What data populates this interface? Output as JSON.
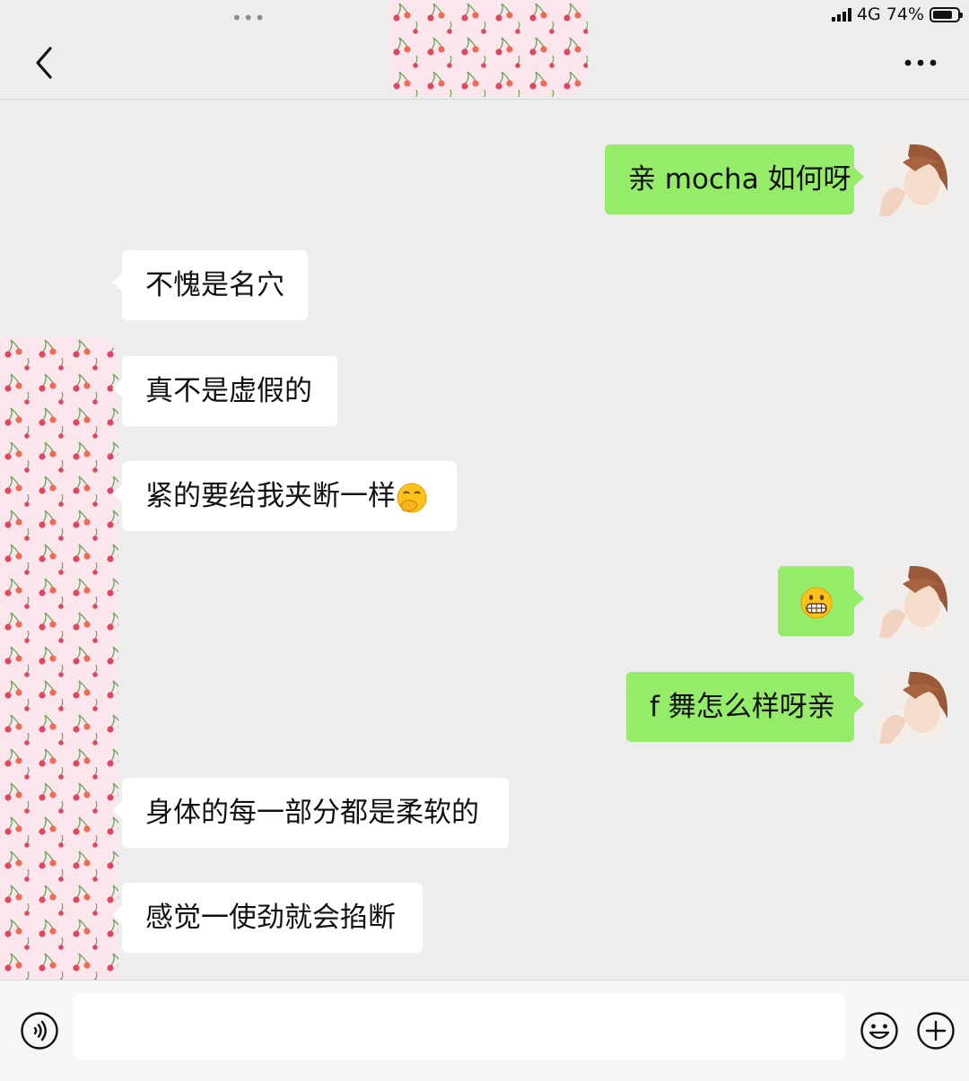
{
  "status_bar": {
    "network": "4G",
    "battery": "74%",
    "battery_level": 0.74
  },
  "header": {
    "top_dots": "•••",
    "back_icon": "chevron-left-icon",
    "more_icon": "ellipsis-icon"
  },
  "messages": [
    {
      "side": "out",
      "text": "亲 mocha 如何呀"
    },
    {
      "side": "in",
      "text": "不愧是名穴"
    },
    {
      "side": "in",
      "text": "真不是虚假的"
    },
    {
      "side": "in",
      "text": "紧的要给我夹断一样",
      "emoji": "hand-over-mouth-emoji"
    },
    {
      "side": "out",
      "text": "",
      "emoji": "grimacing-emoji"
    },
    {
      "side": "out",
      "text": "f 舞怎么样呀亲"
    },
    {
      "side": "in",
      "text": "身体的每一部分都是柔软的"
    },
    {
      "side": "in",
      "text": "感觉一使劲就会掐断"
    }
  ],
  "input_bar": {
    "value": "",
    "voice_icon": "voice-icon",
    "emoji_icon": "smiley-icon",
    "plus_icon": "plus-circle-icon"
  },
  "colors": {
    "background": "#ededed",
    "outgoing_bubble": "#95ec69",
    "incoming_bubble": "#ffffff",
    "mask_pink": "#fce6ee"
  }
}
